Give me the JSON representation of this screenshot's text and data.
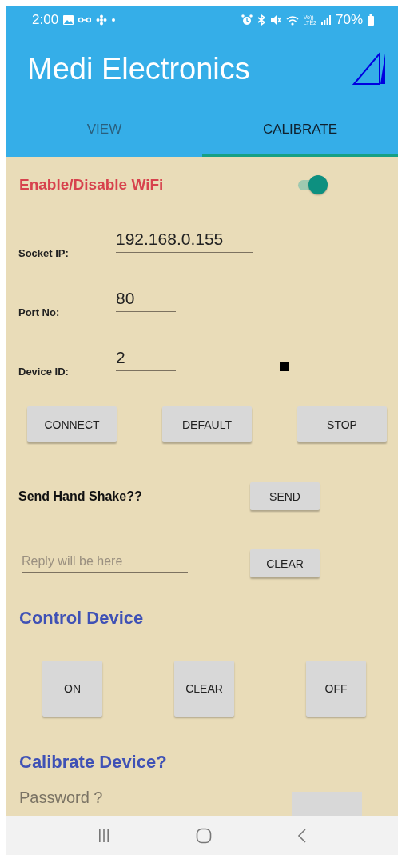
{
  "status_bar": {
    "time": "2:00",
    "volte": "Vo))",
    "lte": "LTE2",
    "battery": "70%"
  },
  "app_bar": {
    "title": "Medi Electronics"
  },
  "tabs": [
    {
      "label": "VIEW",
      "selected": false
    },
    {
      "label": "CALIBRATE",
      "selected": true
    }
  ],
  "wifi": {
    "label": "Enable/Disable WiFi",
    "on": true
  },
  "fields": [
    {
      "label": "Socket IP:",
      "value": "192.168.0.155",
      "kind": "wide"
    },
    {
      "label": "Port No:",
      "value": "80",
      "kind": "short"
    },
    {
      "label": "Device ID:",
      "value": "2",
      "kind": "status"
    }
  ],
  "connection_buttons": [
    "CONNECT",
    "DEFAULT",
    "STOP"
  ],
  "handshake": {
    "label": "Send Hand Shake??",
    "button": "SEND"
  },
  "reply": {
    "placeholder": "Reply will be here",
    "button": "CLEAR"
  },
  "control": {
    "title": "Control Device",
    "buttons": [
      "ON",
      "CLEAR",
      "OFF"
    ]
  },
  "calibrate": {
    "title": "Calibrate Device?",
    "placeholder": "Password ?"
  }
}
